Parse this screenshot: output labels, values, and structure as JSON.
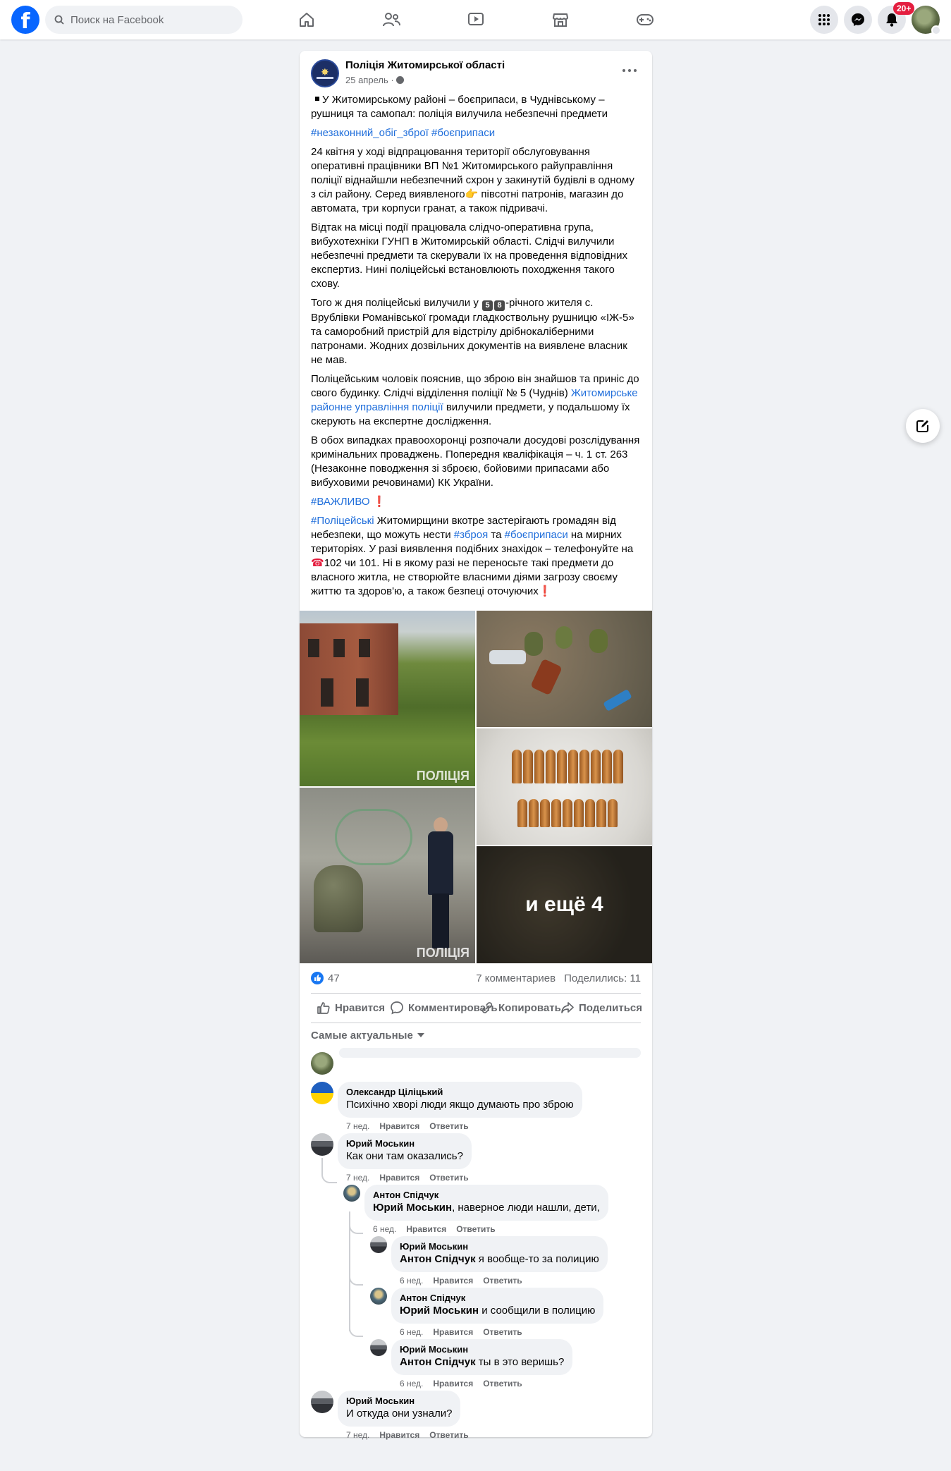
{
  "topbar": {
    "logo_letter": "f",
    "search_placeholder": "Поиск на Facebook",
    "notifications_badge": "20+",
    "nav": [
      "home-icon",
      "friends-icon",
      "watch-icon",
      "marketplace-icon",
      "gaming-icon"
    ],
    "right_icons": [
      "menu-grid-icon",
      "messenger-icon",
      "bell-icon"
    ]
  },
  "post": {
    "page_name": "Поліція Житомирської області",
    "date": "25 апрель ·",
    "headline": "У Житомирському районі – боєприпаси, в Чуднівському – рушниця та самопал: поліція вилучила небезпечні предмети",
    "hashtags_top": [
      "#незаконний_обіг_зброї",
      "#боєприпаси"
    ],
    "p1": "24 квітня у ході відпрацювання території обслуговування оперативні працівники ВП №1 Житомирського райуправління поліції віднайшли небезпечний схрон у закинутій будівлі в одному з сіл району. Серед виявленого",
    "p1_emoji": "👉",
    "p1_end": " півсотні патронів, магазин до автомата, три корпуси гранат, а також підривачі.",
    "p2": "Відтак на місці події працювала слідчо-оперативна група, вибухотехніки ГУНП в Житомирській області. Слідчі вилучили небезпечні предмети та скерували їх на проведення відповідних експертиз. Нині поліцейські встановлюють походження такого схову.",
    "p3_start": "Того ж дня поліцейські вилучили у ",
    "p3_d1": "5",
    "p3_d2": "8",
    "p3_end": "-річного жителя с. Врублівки Романівської громади гладкоствольну рушницю «ІЖ-5» та саморобний пристрій для відстрілу дрібнокаліберними патронами. Жодних дозвільних документів на виявлене власник не мав.",
    "p4_start": "Поліцейським чоловік пояснив, що зброю він знайшов та приніс до свого будинку. Слідчі відділення поліції № 5 (Чуднів) ",
    "p4_link": "Житомирське районне управління поліції",
    "p4_end": " вилучили предмети, у подальшому їх скерують на експертне дослідження.",
    "p5": "В обох випадках правоохоронці розпочали досудові розслідування кримінальних проваджень. Попередня кваліфікація – ч. 1 ст. 263 (Незаконне поводження зі зброєю, бойовими припасами або вибуховими речовинами) КК України.",
    "p6_tag": "#ВАЖЛИВО",
    "p6_mark": "❗",
    "p7_tag1": "#Поліцейські",
    "p7_a": " Житомирщини вкотре застерігають громадян від небезпеки, що можуть нести ",
    "p7_tag2": "#зброя",
    "p7_b": " та ",
    "p7_tag3": "#боєприпаси",
    "p7_c": " на мирних територіях. У разі виявлення подібних знахідок – телефонуйте на ",
    "p7_phone": "☎",
    "p7_d": "102 чи 101. Ні в якому разі не переносьте такі предмети до власного житла, не створюйте власними діями загрозу своєму життю та здоров'ю, а також безпеці оточуючих",
    "p7_mark": "❗",
    "photos_more": "и ещё 4",
    "photo_watermark": "ПОЛІЦІЯ",
    "likes": "47",
    "comments_count": "7 комментариев",
    "shares": "Поделились: 11",
    "actions": {
      "like": "Нравится",
      "comment": "Комментировать",
      "copy": "Копировать",
      "share": "Поделиться"
    },
    "sort_label": "Самые актуальные"
  },
  "comments": [
    {
      "author": "Олександр Ціліцький",
      "text": "Психічно хворі люди якщо думають про зброю",
      "time": "7 нед.",
      "like": "Нравится",
      "reply": "Ответить"
    },
    {
      "author": "Юрий Моськин",
      "text": "Как они там оказались?",
      "time": "7 нед.",
      "like": "Нравится",
      "reply": "Ответить"
    },
    {
      "author": "Антон Спідчук",
      "mention": "Юрий Моськин",
      "text": ", наверное люди нашли, дети,",
      "time": "6 нед.",
      "like": "Нравится",
      "reply": "Ответить"
    },
    {
      "author": "Юрий Моськин",
      "mention": "Антон Спідчук",
      "text": " я вообще-то за полицию",
      "time": "6 нед.",
      "like": "Нравится",
      "reply": "Ответить"
    },
    {
      "author": "Антон Спідчук",
      "mention": "Юрий Моськин",
      "text": " и сообщили в полицию",
      "time": "6 нед.",
      "like": "Нравится",
      "reply": "Ответить"
    },
    {
      "author": "Юрий Моськин",
      "mention": "Антон Спідчук",
      "text": " ты в это веришь?",
      "time": "6 нед.",
      "like": "Нравится",
      "reply": "Ответить"
    },
    {
      "author": "Юрий Моськин",
      "text": "И откуда они узнали?",
      "time": "7 нед.",
      "like": "Нравится",
      "reply": "Ответить"
    }
  ]
}
